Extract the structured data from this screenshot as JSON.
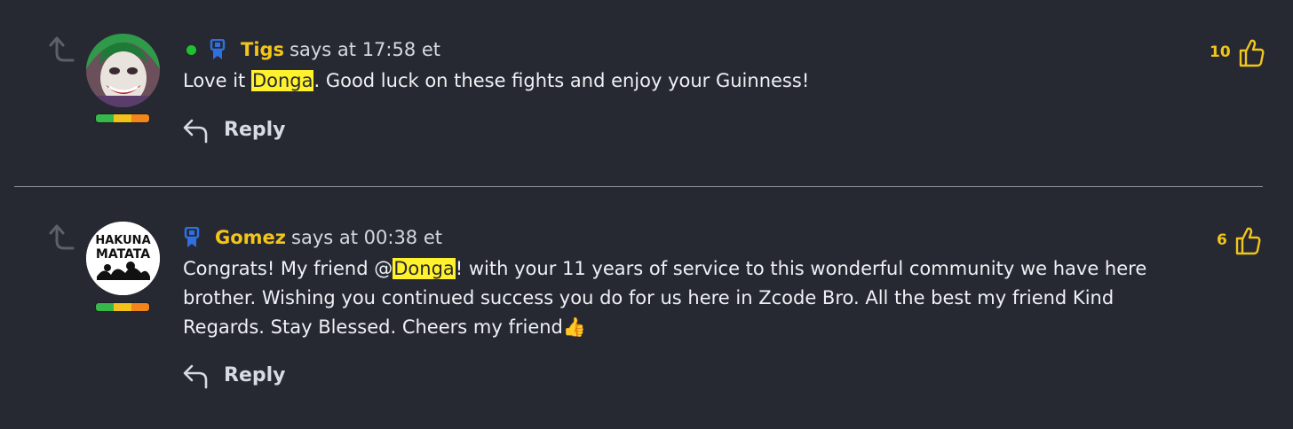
{
  "colors": {
    "background": "#262932",
    "accent": "#f3c51a",
    "highlight": "#fff12d",
    "online": "#20c030"
  },
  "comments": [
    {
      "username": "Tigs",
      "says": "says at 17:58 et",
      "online": true,
      "avatar": "joker-avatar",
      "text_before": "Love it ",
      "mention": "Donga",
      "text_after": ". Good luck on these fights and enjoy your Guinness!",
      "reply_label": "Reply",
      "likes": "10"
    },
    {
      "username": "Gomez",
      "says": "says at 00:38 et",
      "online": false,
      "avatar": "hakuna-matata-avatar",
      "avatar_text_1": "HAKUNA",
      "avatar_text_2": "MATATA",
      "text_before": "Congrats! My friend @",
      "mention": "Donga",
      "text_after": "! with your 11 years of service to this wonderful community we have here brother. Wishing you continued success you do for us here in Zcode Bro. All the best my friend Kind Regards. Stay Blessed. Cheers my friend👍",
      "reply_label": "Reply",
      "likes": "6"
    }
  ]
}
